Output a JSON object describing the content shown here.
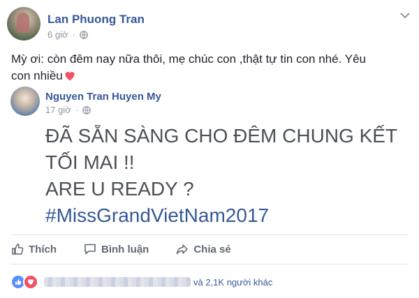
{
  "post": {
    "author": "Lan Phuong Tran",
    "time": "6 giờ",
    "text": "Mỳ ơi: còn đêm nay nữa thôi, mẹ chúc con ,thật tự tin con nhé. Yêu con nhiều"
  },
  "shared_post": {
    "author": "Nguyen Tran Huyen My",
    "time": "17 giờ",
    "lines": [
      "ĐÃ SẴN SÀNG CHO ĐÊM CHUNG KẾT",
      "TỐI MAI !!",
      "ARE U READY ?"
    ],
    "hashtag": "#MissGrandVietNam2017"
  },
  "actions": {
    "like_label": "Thích",
    "comment_label": "Bình luận",
    "share_label": "Chia sẻ"
  },
  "reactions": {
    "others_text": "và 2,1K người khác"
  },
  "icons": [
    "globe-icon",
    "chevron-down-icon",
    "heart-icon",
    "like-icon",
    "comment-icon",
    "share-icon",
    "reaction-like-icon",
    "reaction-love-icon"
  ],
  "colors": {
    "link": "#365899",
    "like_reaction": "#598eff",
    "love_reaction": "#f25268",
    "heart": "#f25268"
  }
}
